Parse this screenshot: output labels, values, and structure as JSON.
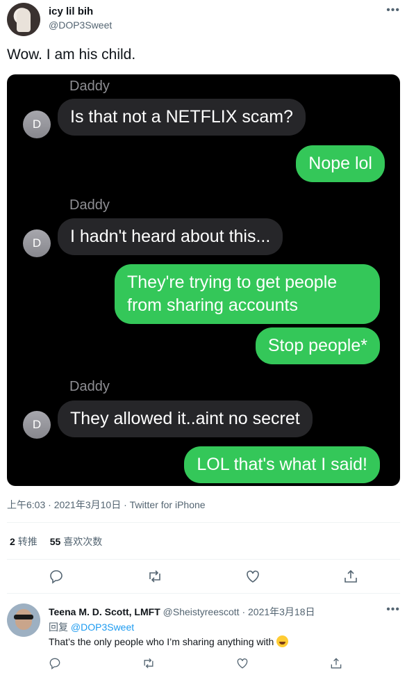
{
  "tweet": {
    "author_name": "icy lil bih",
    "author_handle": "@DOP3Sweet",
    "text": "Wow. I am his child.",
    "meta": "上午6:03 · 2021年3月10日 · Twitter for iPhone",
    "retweets_count": "2",
    "retweets_label": "转推",
    "likes_count": "55",
    "likes_label": "喜欢次数",
    "more_label": "•••"
  },
  "screenshot": {
    "messages": [
      {
        "sender": "Daddy",
        "avatar": "D",
        "text": "Is that not a NETFLIX scam?",
        "direction": "in"
      },
      {
        "text": "Nope lol",
        "direction": "out"
      },
      {
        "sender": "Daddy",
        "avatar": "D",
        "text": "I hadn't heard about this...",
        "direction": "in"
      },
      {
        "text": "They're trying to get people from sharing accounts",
        "direction": "out"
      },
      {
        "text": "Stop people*",
        "direction": "out"
      },
      {
        "sender": "Daddy",
        "avatar": "D",
        "text": "They allowed it..aint no secret",
        "direction": "in"
      },
      {
        "text": "LOL that's what I said!",
        "direction": "out"
      }
    ],
    "colors": {
      "incoming": "#262629",
      "outgoing": "#34c759",
      "background": "#000000"
    }
  },
  "reply": {
    "author_name": "Teena M. D. Scott, LMFT",
    "author_handle": "@Sheistyreescott",
    "date": "· 2021年3月18日",
    "reply_prefix": "回复",
    "reply_to": "@DOP3Sweet",
    "text": "That’s the only people who I’m sharing anything with",
    "emoji": "rolling-on-floor-laughing",
    "more_label": "•••"
  },
  "icons": [
    "reply-icon",
    "retweet-icon",
    "like-icon",
    "share-icon"
  ]
}
